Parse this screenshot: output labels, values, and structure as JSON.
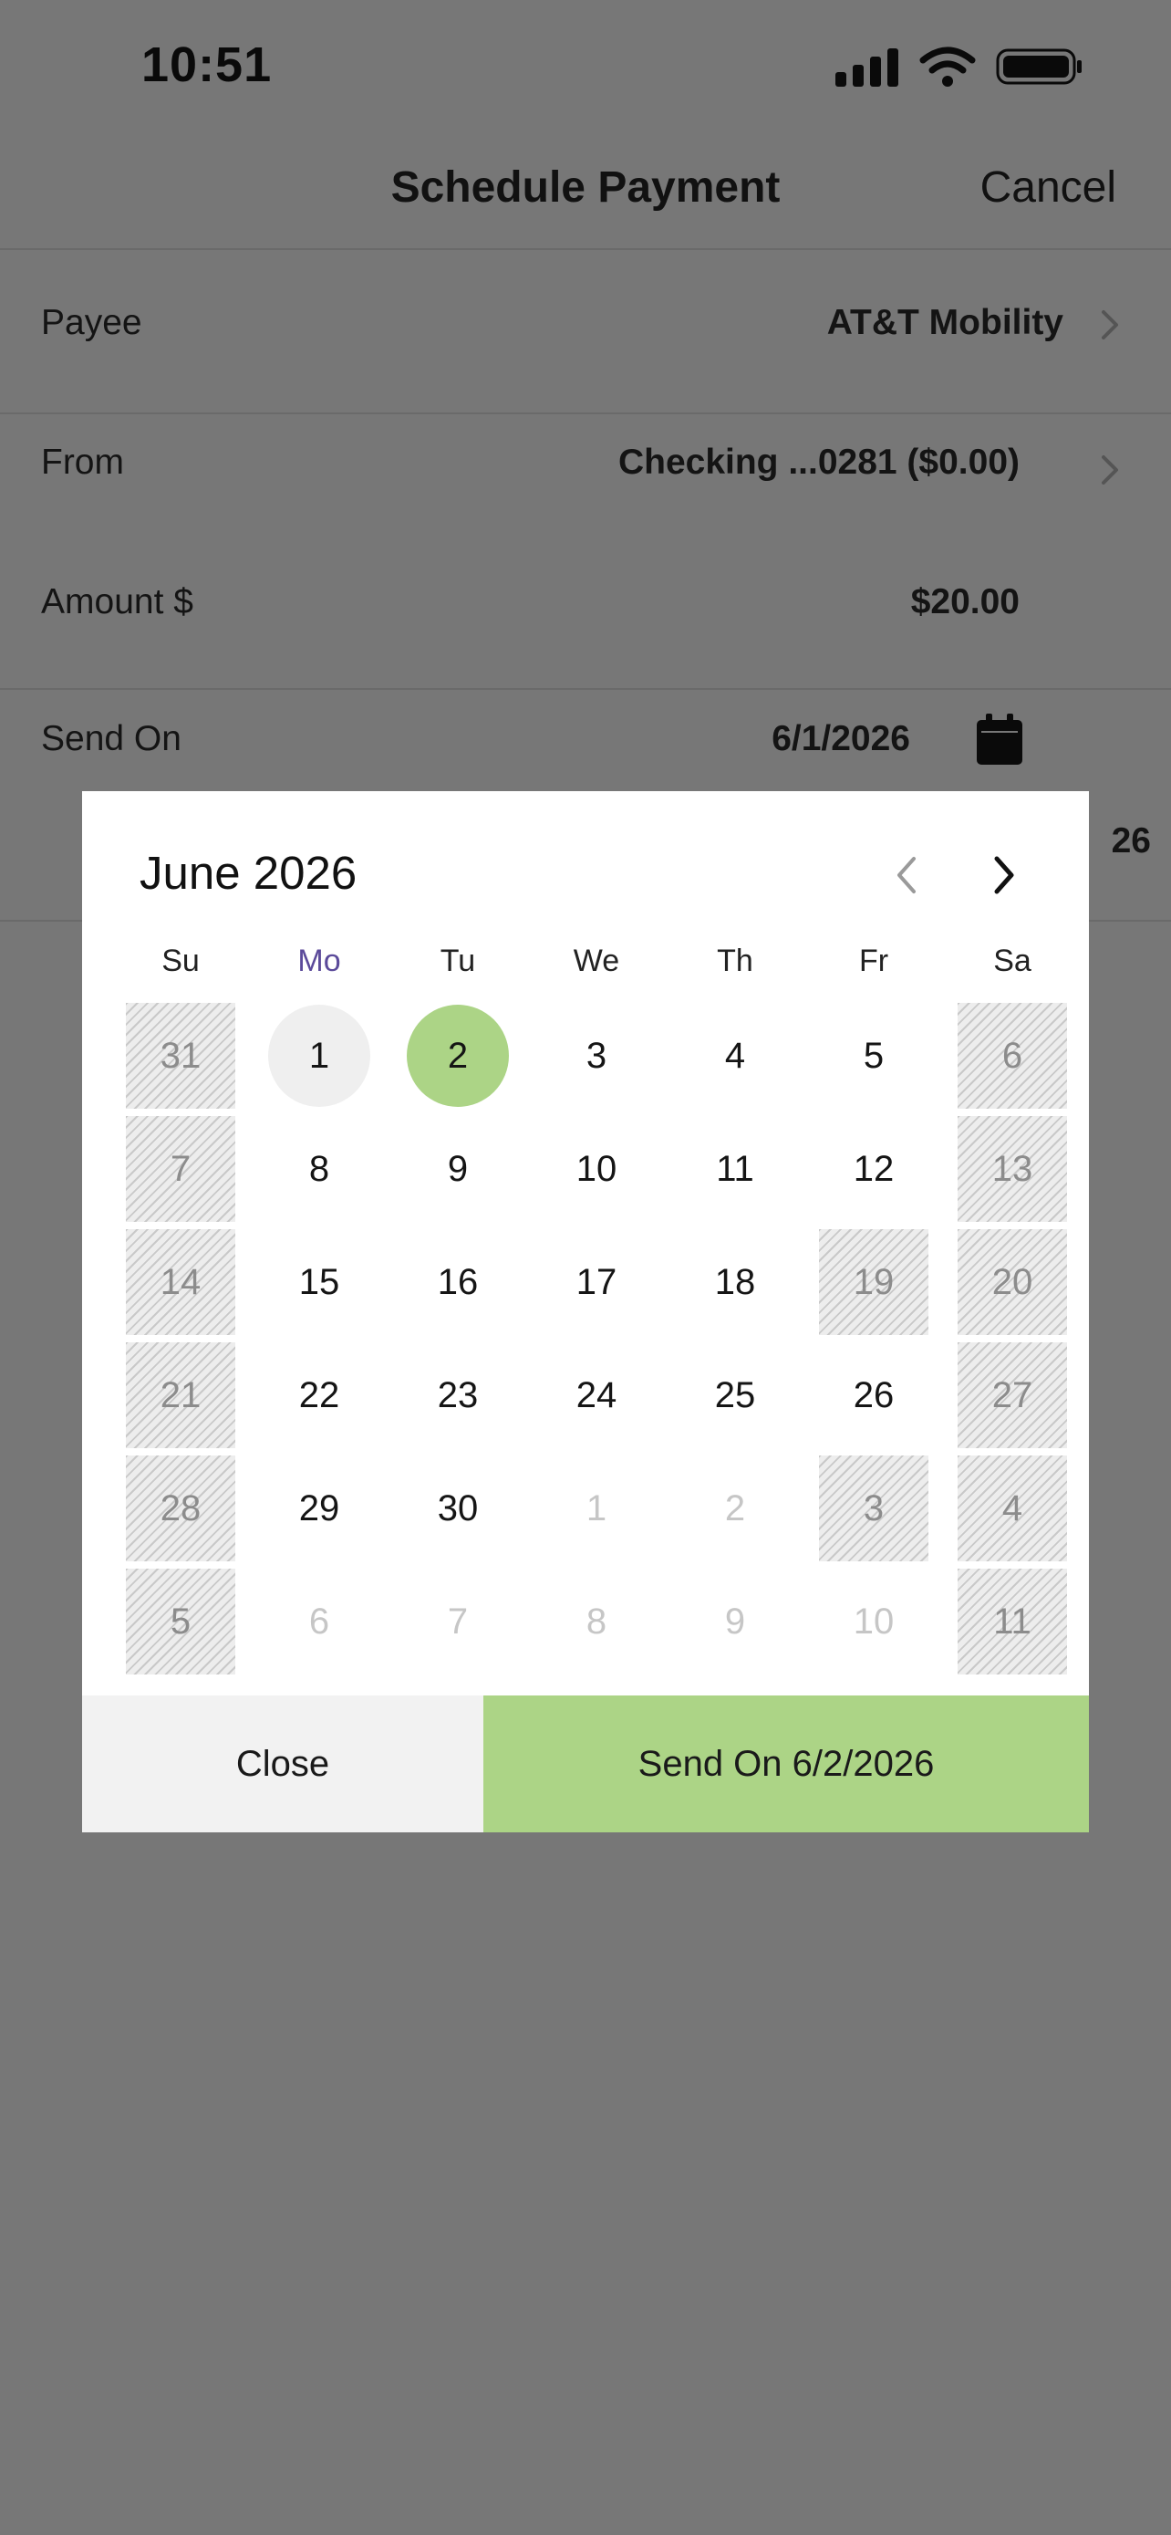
{
  "status_bar": {
    "time": "10:51"
  },
  "nav": {
    "title": "Schedule Payment",
    "cancel_label": "Cancel"
  },
  "form": {
    "payee": {
      "label": "Payee",
      "value": "AT&T Mobility"
    },
    "from": {
      "label": "From",
      "value": "Checking ...0281 ($0.00)"
    },
    "amount": {
      "label": "Amount $",
      "value": "$20.00"
    },
    "send_on": {
      "label": "Send On",
      "value": "6/1/2026"
    },
    "peek_value": "26"
  },
  "calendar": {
    "month_label": "June 2026",
    "weekdays": [
      "Su",
      "Mo",
      "Tu",
      "We",
      "Th",
      "Fr",
      "Sa"
    ],
    "today_weekday_index": 1,
    "days": [
      {
        "d": "31",
        "state": "disabled"
      },
      {
        "d": "1",
        "state": "today"
      },
      {
        "d": "2",
        "state": "selected"
      },
      {
        "d": "3",
        "state": "normal"
      },
      {
        "d": "4",
        "state": "normal"
      },
      {
        "d": "5",
        "state": "normal"
      },
      {
        "d": "6",
        "state": "disabled"
      },
      {
        "d": "7",
        "state": "disabled"
      },
      {
        "d": "8",
        "state": "normal"
      },
      {
        "d": "9",
        "state": "normal"
      },
      {
        "d": "10",
        "state": "normal"
      },
      {
        "d": "11",
        "state": "normal"
      },
      {
        "d": "12",
        "state": "normal"
      },
      {
        "d": "13",
        "state": "disabled"
      },
      {
        "d": "14",
        "state": "disabled"
      },
      {
        "d": "15",
        "state": "normal"
      },
      {
        "d": "16",
        "state": "normal"
      },
      {
        "d": "17",
        "state": "normal"
      },
      {
        "d": "18",
        "state": "normal"
      },
      {
        "d": "19",
        "state": "disabled"
      },
      {
        "d": "20",
        "state": "disabled"
      },
      {
        "d": "21",
        "state": "disabled"
      },
      {
        "d": "22",
        "state": "normal"
      },
      {
        "d": "23",
        "state": "normal"
      },
      {
        "d": "24",
        "state": "normal"
      },
      {
        "d": "25",
        "state": "normal"
      },
      {
        "d": "26",
        "state": "normal"
      },
      {
        "d": "27",
        "state": "disabled"
      },
      {
        "d": "28",
        "state": "disabled"
      },
      {
        "d": "29",
        "state": "normal"
      },
      {
        "d": "30",
        "state": "normal"
      },
      {
        "d": "1",
        "state": "other"
      },
      {
        "d": "2",
        "state": "other"
      },
      {
        "d": "3",
        "state": "disabled"
      },
      {
        "d": "4",
        "state": "disabled"
      },
      {
        "d": "5",
        "state": "disabled"
      },
      {
        "d": "6",
        "state": "other"
      },
      {
        "d": "7",
        "state": "other"
      },
      {
        "d": "8",
        "state": "other"
      },
      {
        "d": "9",
        "state": "other"
      },
      {
        "d": "10",
        "state": "other"
      },
      {
        "d": "11",
        "state": "disabled"
      }
    ]
  },
  "modal_footer": {
    "close_label": "Close",
    "send_label": "Send On 6/2/2026"
  },
  "colors": {
    "overlay": "#777777",
    "accent": "#acd486",
    "today_weekday": "#5b4a9a"
  },
  "icons": {
    "prev": "chevron-left-icon",
    "next": "chevron-right-icon",
    "calendar": "calendar-icon"
  }
}
